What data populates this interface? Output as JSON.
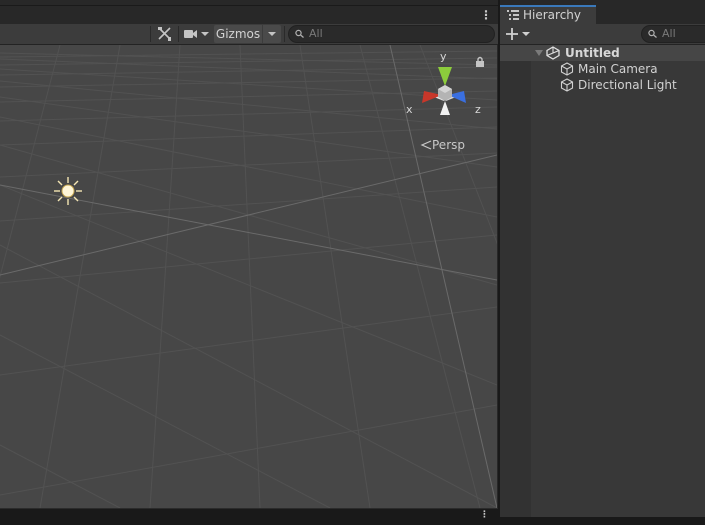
{
  "scene_view": {
    "toolbar": {
      "gizmos_label": "Gizmos",
      "search_placeholder": "All"
    },
    "orientation": {
      "axis_y": "y",
      "axis_x": "x",
      "axis_z": "z",
      "projection_label": "Persp"
    }
  },
  "hierarchy": {
    "tab_label": "Hierarchy",
    "search_placeholder": "All",
    "scene_name": "Untitled",
    "objects": [
      {
        "name": "Main Camera",
        "icon": "gameobject-cube-icon"
      },
      {
        "name": "Directional Light",
        "icon": "gameobject-cube-icon"
      }
    ]
  },
  "colors": {
    "active_tab_accent": "#3a79bb",
    "gizmo_y": "#8ccc3c",
    "gizmo_x": "#c8372a",
    "gizmo_z": "#3a6fe0"
  }
}
